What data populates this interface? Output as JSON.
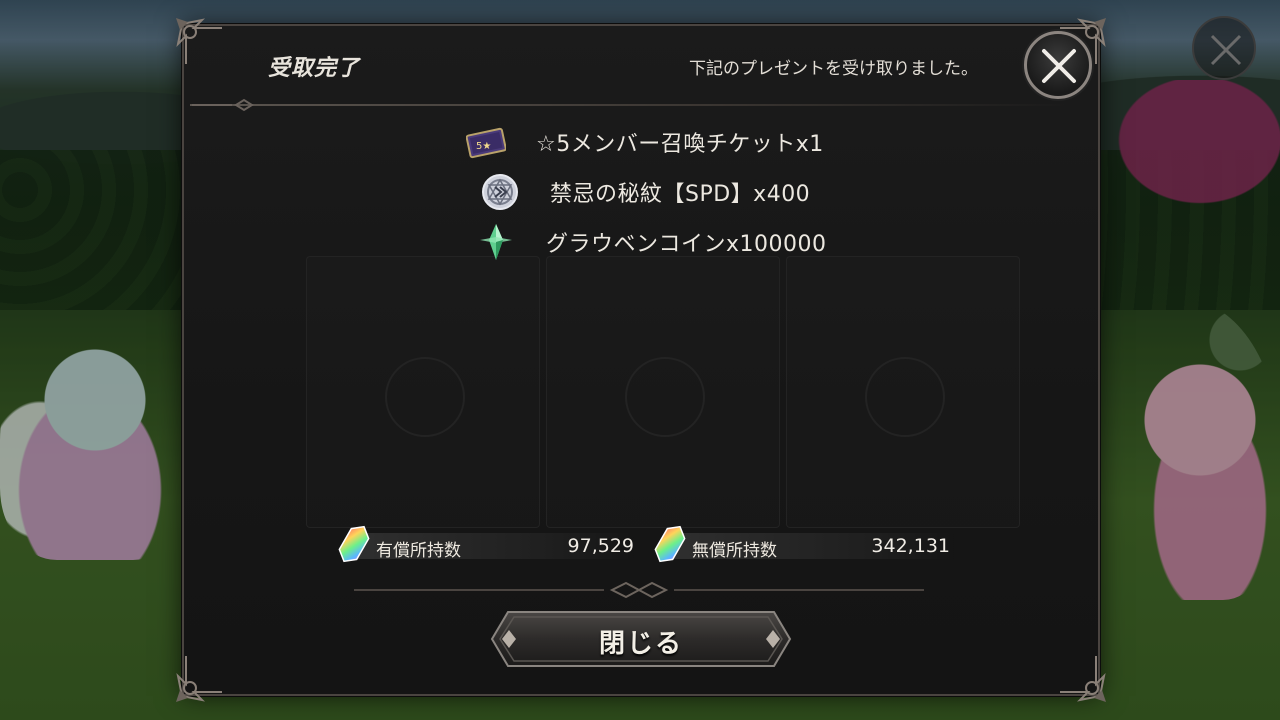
{
  "dialog": {
    "title": "受取完了",
    "subtitle": "下記のプレゼントを受け取りました。",
    "rewards": [
      {
        "icon": "summon-ticket-icon",
        "text": "☆5メンバー召喚チケットx1",
        "badge": "5★"
      },
      {
        "icon": "seal-emblem-icon",
        "text": "禁忌の秘紋【SPD】x400"
      },
      {
        "icon": "green-crystal-icon",
        "text": "グラウベンコインx100000"
      }
    ],
    "currency": {
      "paid_label": "有償所持数",
      "paid_value": "97,529",
      "free_label": "無償所持数",
      "free_value": "342,131"
    },
    "close_button": "閉じる"
  },
  "colors": {
    "panel_bg": "#1a1a1a",
    "frame": "#4a4440",
    "text": "#ece8e0"
  }
}
